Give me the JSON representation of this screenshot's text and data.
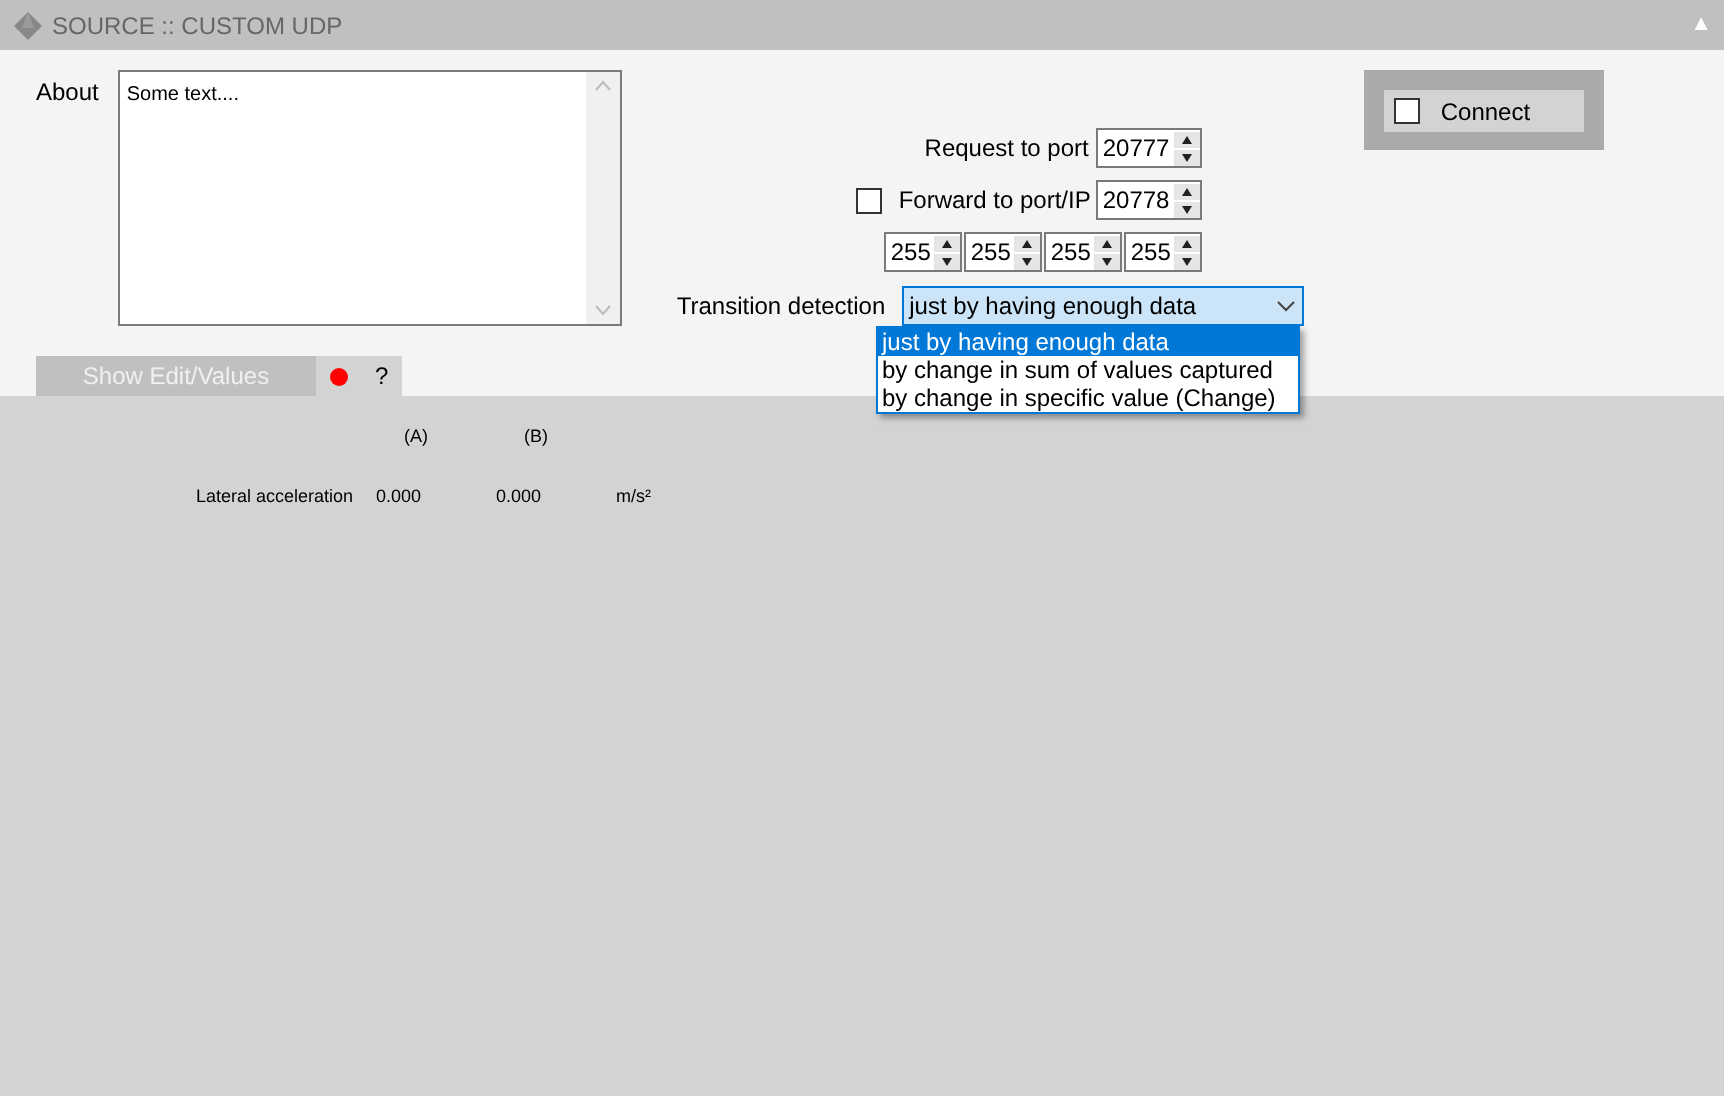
{
  "window": {
    "title": "SOURCE :: CUSTOM UDP",
    "collapse_glyph": "▲"
  },
  "about": {
    "label": "About",
    "value": "Some text...."
  },
  "request_port": {
    "label": "Request to port",
    "value": "20777"
  },
  "forward": {
    "label": "Forward to port/IP",
    "checked": false,
    "value": "20778"
  },
  "ip": [
    "255",
    "255",
    "255",
    "255"
  ],
  "transition": {
    "label": "Transition detection",
    "value": "just by having enough data",
    "expanded": true,
    "options": [
      {
        "label": "just by having enough data",
        "selected": true
      },
      {
        "label": "by change in sum of values captured",
        "selected": false
      },
      {
        "label": "by change in specific value (Change)",
        "selected": false
      }
    ]
  },
  "connect": {
    "label": "Connect",
    "checked": false
  },
  "tabs": {
    "show_button": "Show Edit/Values",
    "status_dot": {
      "color": "#ff0000"
    },
    "help": "?"
  },
  "values": {
    "columns": [
      "(A)",
      "(B)"
    ],
    "rows": [
      {
        "name": "Lateral acceleration",
        "a": "0.000",
        "b": "0.000",
        "unit": "m/s²"
      }
    ]
  }
}
